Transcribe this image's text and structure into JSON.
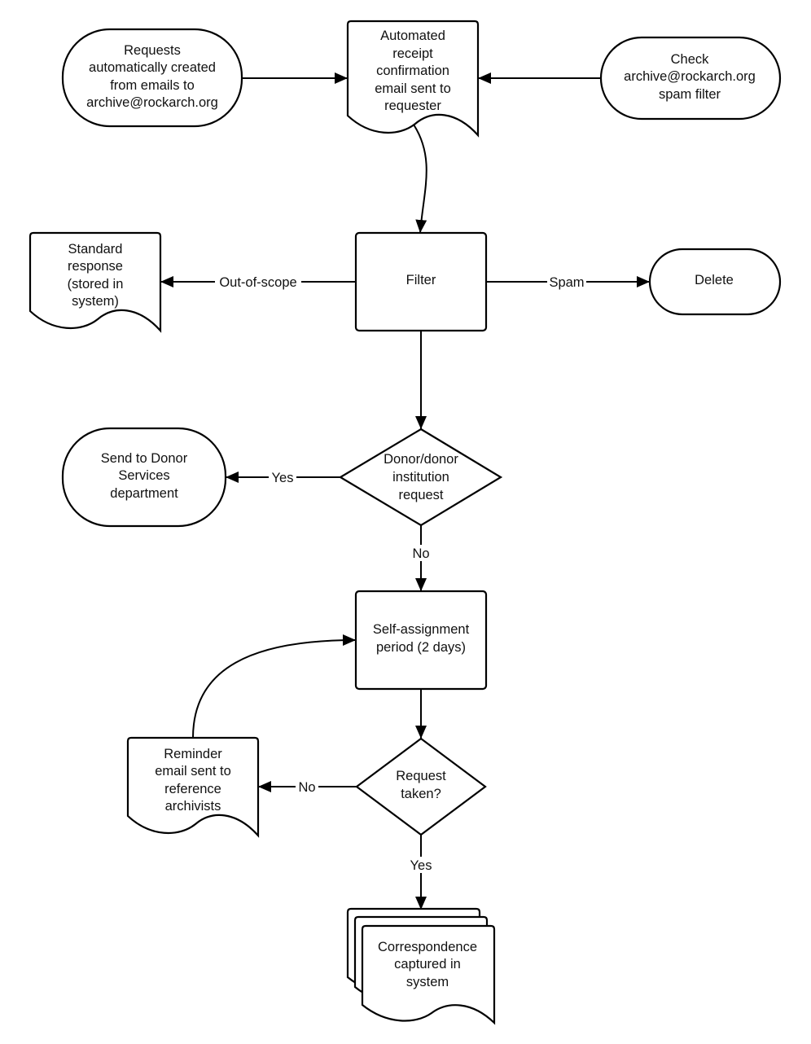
{
  "nodes": {
    "requests_created": {
      "type": "terminator",
      "lines": [
        "Requests",
        "automatically created",
        "from emails to",
        "archive@rockarch.org"
      ]
    },
    "receipt_email": {
      "type": "document",
      "lines": [
        "Automated",
        "receipt",
        "confirmation",
        "email sent to",
        "requester"
      ]
    },
    "check_spam": {
      "type": "terminator",
      "lines": [
        "Check",
        "archive@rockarch.org",
        "spam filter"
      ]
    },
    "filter": {
      "type": "process",
      "lines": [
        "Filter"
      ]
    },
    "standard_response": {
      "type": "document",
      "lines": [
        "Standard",
        "response",
        "(stored in",
        "system)"
      ]
    },
    "delete": {
      "type": "terminator",
      "lines": [
        "Delete"
      ]
    },
    "donor_request": {
      "type": "decision",
      "lines": [
        "Donor/donor",
        "institution",
        "request"
      ]
    },
    "donor_services": {
      "type": "terminator",
      "lines": [
        "Send to Donor",
        "Services",
        "department"
      ]
    },
    "self_assignment": {
      "type": "process",
      "lines": [
        "Self-assignment",
        "period (2 days)"
      ]
    },
    "request_taken": {
      "type": "decision",
      "lines": [
        "Request",
        "taken?"
      ]
    },
    "reminder_email": {
      "type": "document",
      "lines": [
        "Reminder",
        "email sent to",
        "reference",
        "archivists"
      ]
    },
    "correspondence": {
      "type": "multi-document",
      "lines": [
        "Correspondence",
        "captured in",
        "system"
      ]
    }
  },
  "edges": {
    "requests_to_receipt": {
      "from": "requests_created",
      "to": "receipt_email",
      "label": ""
    },
    "spam_to_receipt": {
      "from": "check_spam",
      "to": "receipt_email",
      "label": ""
    },
    "receipt_to_filter": {
      "from": "receipt_email",
      "to": "filter",
      "label": ""
    },
    "filter_to_standard": {
      "from": "filter",
      "to": "standard_response",
      "label": "Out-of-scope"
    },
    "filter_to_delete": {
      "from": "filter",
      "to": "delete",
      "label": "Spam"
    },
    "filter_to_donor": {
      "from": "filter",
      "to": "donor_request",
      "label": ""
    },
    "donor_yes": {
      "from": "donor_request",
      "to": "donor_services",
      "label": "Yes"
    },
    "donor_no": {
      "from": "donor_request",
      "to": "self_assignment",
      "label": "No"
    },
    "assign_to_taken": {
      "from": "self_assignment",
      "to": "request_taken",
      "label": ""
    },
    "taken_no": {
      "from": "request_taken",
      "to": "reminder_email",
      "label": "No"
    },
    "reminder_to_assign": {
      "from": "reminder_email",
      "to": "self_assignment",
      "label": ""
    },
    "taken_yes": {
      "from": "request_taken",
      "to": "correspondence",
      "label": "Yes"
    }
  }
}
